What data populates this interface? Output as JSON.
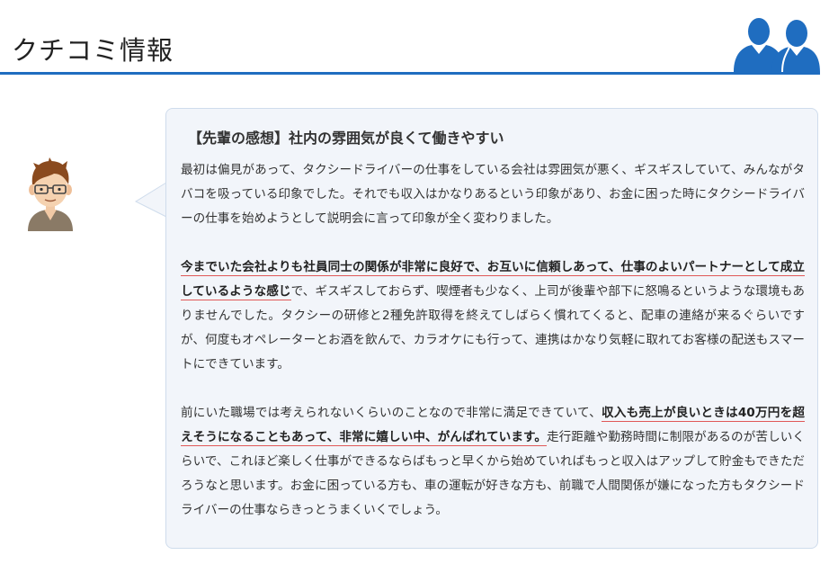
{
  "header": {
    "title": "クチコミ情報",
    "icon": "people-icon",
    "accent_color": "#1f6dc0"
  },
  "review": {
    "avatar": "avatar-icon",
    "title": "【先輩の感想】社内の雰囲気が良くて働きやすい",
    "paragraphs": [
      {
        "text": "最初は偏見があって、タクシードライバーの仕事をしている会社は雰囲気が悪く、ギスギスしていて、みんながタバコを吸っている印象でした。それでも収入はかなりあるという印象があり、お金に困った時にタクシードライバーの仕事を始めようとして説明会に言って印象が全く変わりました。"
      },
      {
        "highlight": "今までいた会社よりも社員同士の関係が非常に良好で、お互いに信頼しあって、仕事のよいパートナーとして成立しているような感じ",
        "text_after": "で、ギスギスしておらず、喫煙者も少なく、上司が後輩や部下に怒鳴るというような環境もありませんでした。タクシーの研修と2種免許取得を終えてしばらく慣れてくると、配車の連絡が来るぐらいですが、何度もオペレーターとお酒を飲んで、カラオケにも行って、連携はかなり気軽に取れてお客様の配送もスマートにできています。"
      },
      {
        "text_before": "前にいた職場では考えられないくらいのことなので非常に満足できていて、",
        "highlight": "収入も売上が良いときは40万円を超えそうになることもあって、非常に嬉しい中、がんばれています。",
        "text_after": "走行距離や勤務時間に制限があるのが苦しいくらいで、これほど楽しく仕事ができるならばもっと早くから始めていればもっと収入はアップして貯金もできただろうなと思います。お金に困っている方も、車の運転が好きな方も、前職で人間関係が嫌になった方もタクシードライバーの仕事ならきっとうまくいくでしょう。"
      }
    ],
    "bubble_color": "#f2f5fa",
    "highlight_underline_color": "#e05858"
  }
}
